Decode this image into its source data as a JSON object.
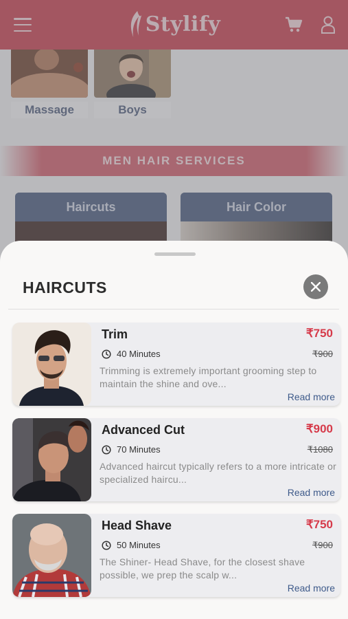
{
  "app": {
    "name": "Stylify"
  },
  "header": {
    "menu_icon": "hamburger-icon",
    "cart_icon": "cart-icon",
    "profile_icon": "user-icon"
  },
  "categories": [
    {
      "label": "Massage"
    },
    {
      "label": "Boys"
    }
  ],
  "section": {
    "title": "MEN HAIR SERVICES"
  },
  "service_cards": [
    {
      "label": "Haircuts"
    },
    {
      "label": "Hair Color"
    }
  ],
  "sheet": {
    "title": "HAIRCUTS",
    "close_icon": "close-icon",
    "items": [
      {
        "name": "Trim",
        "price": "₹750",
        "old_price": "₹900",
        "duration": "40 Minutes",
        "description": "Trimming is extremely important grooming step to maintain the shine and ove...",
        "read_more": "Read more"
      },
      {
        "name": "Advanced Cut",
        "price": "₹900",
        "old_price": "₹1080",
        "duration": "70 Minutes",
        "description": "Advanced haircut typically refers to a more intricate or specialized haircu...",
        "read_more": "Read more"
      },
      {
        "name": "Head Shave",
        "price": "₹750",
        "old_price": "₹900",
        "duration": "50 Minutes",
        "description": "The Shiner- Head Shave, for the closest shave possible, we prep the scalp w...",
        "read_more": "Read more"
      }
    ]
  },
  "colors": {
    "brand": "#c73b4c",
    "price": "#d63a4a",
    "link": "#3e5a8a",
    "card_head": "#45587c"
  }
}
